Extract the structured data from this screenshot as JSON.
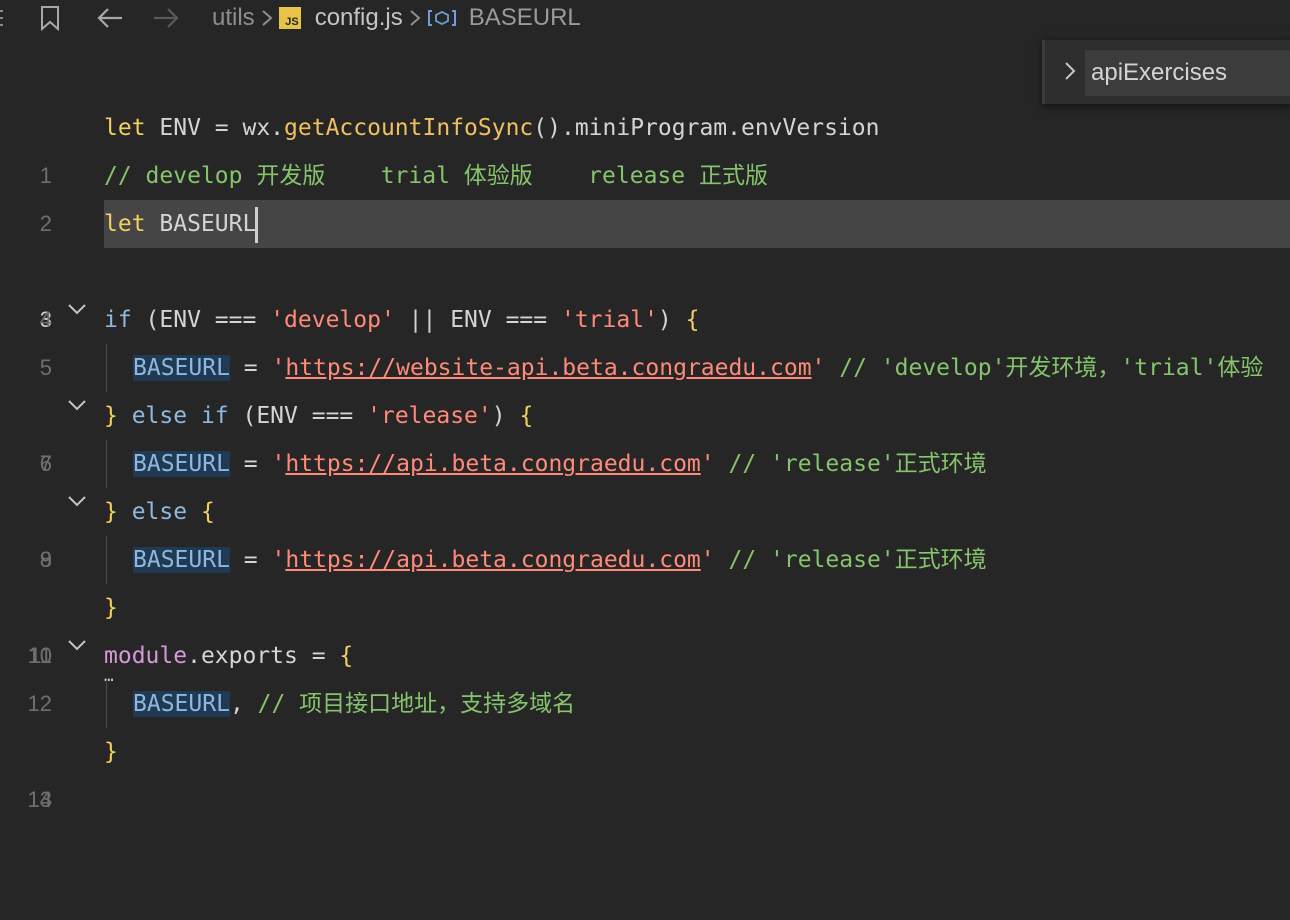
{
  "icons": {
    "bookmark": "bookmark-icon",
    "back": "arrow-left-icon",
    "forward": "arrow-right-icon",
    "js_file": "js-file-icon",
    "variable": "variable-icon",
    "fold": "chevron-down-icon",
    "find_toggle": "chevron-right-icon"
  },
  "breadcrumb": {
    "folder": "utils",
    "file": "config.js",
    "file_badge": "JS",
    "symbol": "BASEURL"
  },
  "find_widget": {
    "value": "apiExercises"
  },
  "editor": {
    "line_numbers": [
      "1",
      "2",
      "3",
      "4",
      "5",
      "6",
      "7",
      "8",
      "9",
      "10",
      "11",
      "12",
      "13",
      "14"
    ],
    "active_line": "3",
    "lines": {
      "l1": {
        "kw": "let",
        "v1": " ENV = wx.",
        "fn": "getAccountInfoSync",
        "v2": "().miniProgram.envVersion"
      },
      "l2": {
        "comment": "// develop 开发版    trial 体验版    release 正式版"
      },
      "l3": {
        "kw": "let",
        "v1": " BASEURL"
      },
      "l5": {
        "kw": "if",
        "p1": " (ENV === ",
        "s1": "'develop'",
        "p2": " || ENV === ",
        "s2": "'trial'",
        "p3": ") ",
        "b": "{"
      },
      "l6": {
        "var": "BASEURL",
        "p1": " = ",
        "q1": "'",
        "url": "https://website-api.beta.congraedu.com",
        "q2": "'",
        "comment": " // 'develop'开发环境，'trial'体验"
      },
      "l7": {
        "b1": "}",
        "kw1": " else if",
        "p1": " (ENV === ",
        "s1": "'release'",
        "p2": ") ",
        "b2": "{"
      },
      "l8": {
        "var": "BASEURL",
        "p1": " = ",
        "q1": "'",
        "url": "https://api.beta.congraedu.com",
        "q2": "'",
        "comment": " // 'release'正式环境"
      },
      "l9": {
        "b1": "}",
        "kw1": " else",
        "b2": " {"
      },
      "l10": {
        "var": "BASEURL",
        "p1": " = ",
        "q1": "'",
        "url": "https://api.beta.congraedu.com",
        "q2": "'",
        "comment": " // 'release'正式环境"
      },
      "l11": {
        "b": "}"
      },
      "l12": {
        "mod": "module",
        "p1": ".exports = ",
        "b": "{",
        "ellipsis": "…"
      },
      "l13": {
        "var": "BASEURL",
        "p1": ",",
        "comment": " // 项目接口地址，支持多域名"
      },
      "l14": {
        "b": "}"
      }
    }
  }
}
